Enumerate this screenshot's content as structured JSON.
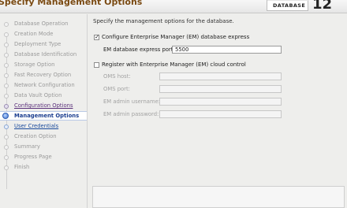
{
  "header": {
    "title": "Specify Management Options",
    "logo_text": "DATABASE",
    "version": "12"
  },
  "nav": {
    "items": [
      {
        "label": "Database Operation"
      },
      {
        "label": "Creation Mode"
      },
      {
        "label": "Deployment Type"
      },
      {
        "label": "Database Identification"
      },
      {
        "label": "Storage Option"
      },
      {
        "label": "Fast Recovery Option"
      },
      {
        "label": "Network Configuration"
      },
      {
        "label": "Data Vault Option"
      },
      {
        "label": "Configuration Options"
      },
      {
        "label": "Management Options"
      },
      {
        "label": "User Credentials"
      },
      {
        "label": "Creation Option"
      },
      {
        "label": "Summary"
      },
      {
        "label": "Progress Page"
      },
      {
        "label": "Finish"
      }
    ]
  },
  "main": {
    "intro": "Specify the management options for the database.",
    "em_express": {
      "checked": true,
      "label": "Configure Enterprise Manager (EM) database express",
      "port_label": "EM database express port:",
      "port_value": "5500"
    },
    "cloud_control": {
      "checked": false,
      "label": "Register with Enterprise Manager (EM) cloud control",
      "fields": [
        {
          "label": "OMS host:",
          "value": ""
        },
        {
          "label": "OMS port:",
          "value": ""
        },
        {
          "label": "EM admin username:",
          "value": ""
        },
        {
          "label": "EM admin password:",
          "value": ""
        }
      ]
    }
  }
}
